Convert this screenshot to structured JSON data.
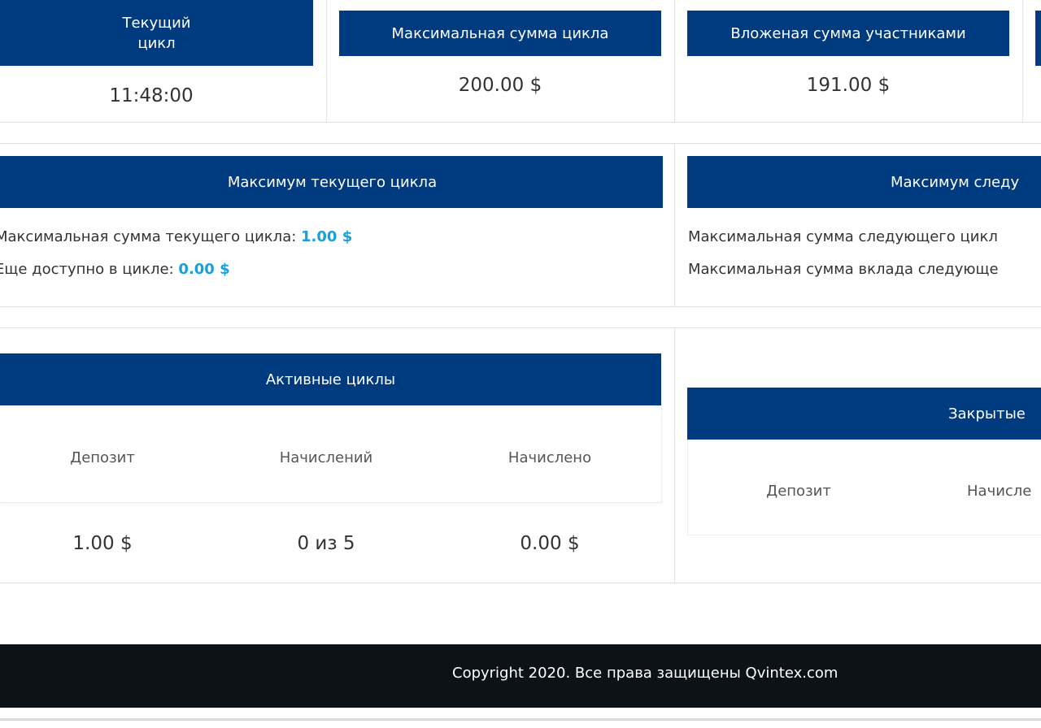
{
  "stats": {
    "current_cycle": {
      "title": "Текущий\nцикл",
      "value": "11:48:00"
    },
    "max_cycle_sum": {
      "title": "Максимальная сумма цикла",
      "value": "200.00 $"
    },
    "invested_sum": {
      "title": "Вложеная сумма участниками",
      "value": "191.00 $"
    }
  },
  "current_max": {
    "title": "Максимум текущего цикла",
    "max_label": "Максимальная сумма текущего цикла:",
    "max_value": "1.00 $",
    "avail_label": "Еще доступно в цикле:",
    "avail_value": "0.00 $"
  },
  "next_max": {
    "title": "Максимум следу",
    "line1": "Максимальная сумма следующего цикл",
    "line2": "Максимальная сумма вклада следующе"
  },
  "active_cycles": {
    "title": "Активные циклы",
    "columns": [
      "Депозит",
      "Начислений",
      "Начислено"
    ],
    "rows": [
      [
        "1.00 $",
        "0 из 5",
        "0.00 $"
      ]
    ]
  },
  "closed_cycles": {
    "title": "Закрытые",
    "columns": [
      "Депозит",
      "Начисле"
    ]
  },
  "footer": {
    "copyright": "Copyright 2020. Все права защищены Qvintex.com"
  },
  "colors": {
    "header_blue": "#003b80",
    "accent": "#1a9fd8",
    "footer_bg": "#0d1219"
  }
}
